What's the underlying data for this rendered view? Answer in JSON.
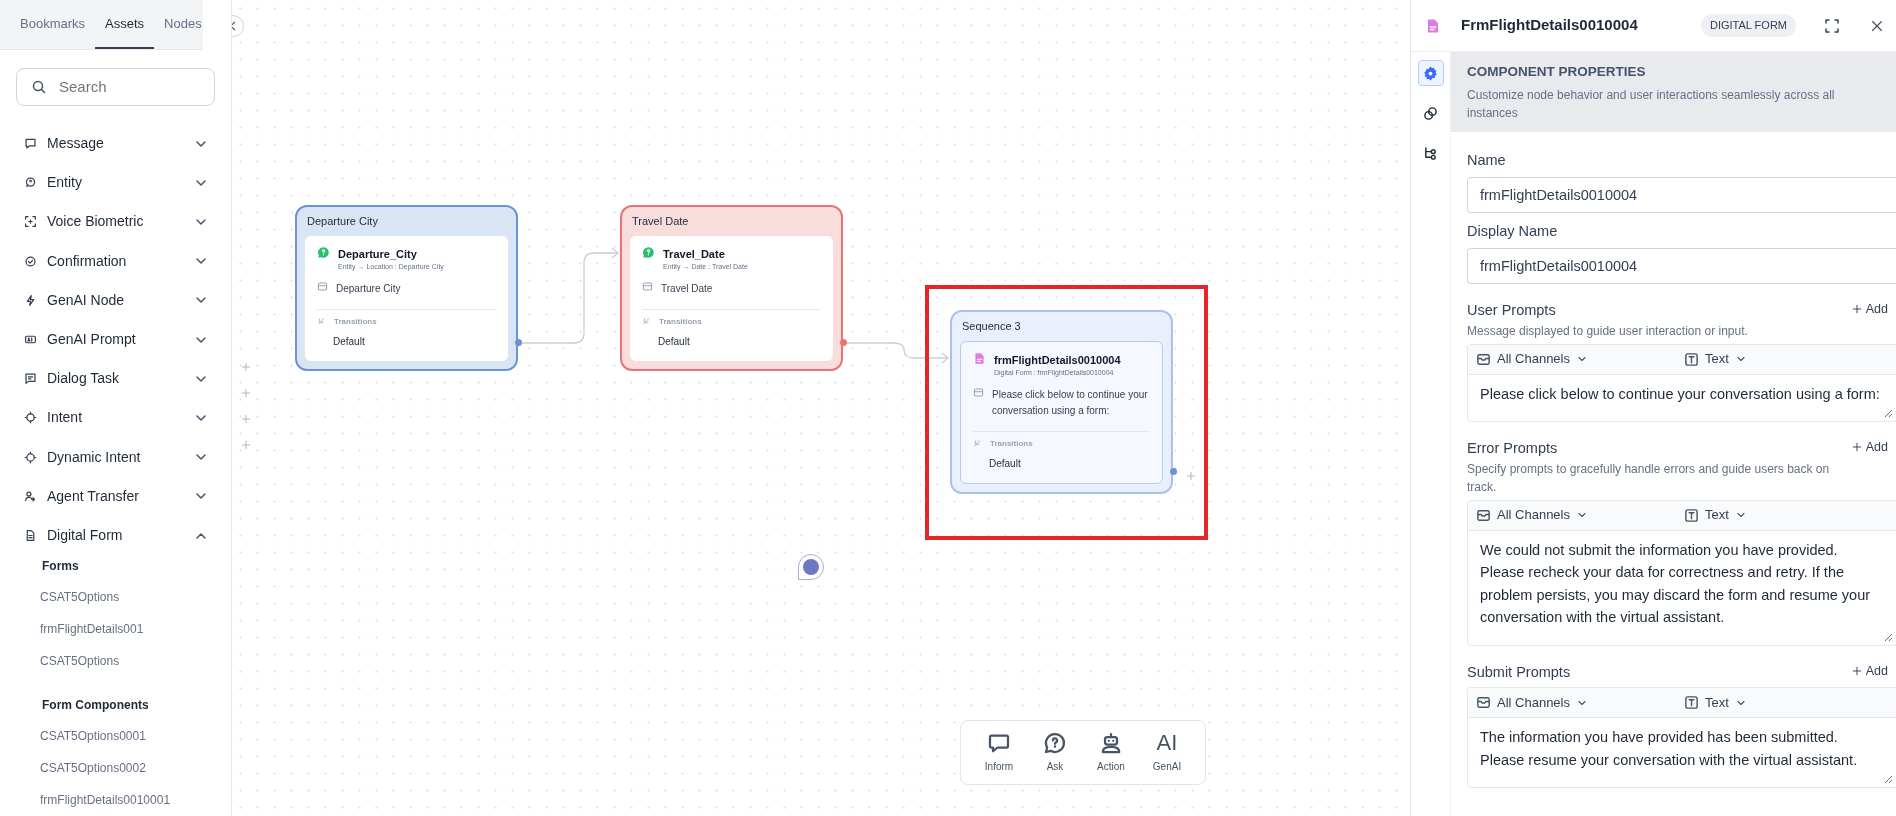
{
  "sidebar": {
    "tabs": [
      {
        "label": "Bookmarks",
        "selected": false
      },
      {
        "label": "Assets",
        "selected": true
      },
      {
        "label": "Nodes",
        "selected": false
      }
    ],
    "search": {
      "placeholder": "Search"
    },
    "items": [
      {
        "label": "Message",
        "expanded": false
      },
      {
        "label": "Entity",
        "expanded": false
      },
      {
        "label": "Voice Biometric",
        "expanded": false
      },
      {
        "label": "Confirmation",
        "expanded": false
      },
      {
        "label": "GenAI Node",
        "expanded": false
      },
      {
        "label": "GenAI Prompt",
        "expanded": false
      },
      {
        "label": "Dialog Task",
        "expanded": false
      },
      {
        "label": "Intent",
        "expanded": false
      },
      {
        "label": "Dynamic Intent",
        "expanded": false
      },
      {
        "label": "Agent Transfer",
        "expanded": false
      },
      {
        "label": "Digital Form",
        "expanded": true,
        "groups": [
          {
            "heading": "Forms",
            "items": [
              "CSAT5Options",
              "frmFlightDetails001",
              "CSAT5Options"
            ]
          },
          {
            "heading": "Form Components",
            "items": [
              "CSAT5Options0001",
              "CSAT5Options0002",
              "frmFlightDetails0010001"
            ]
          }
        ]
      }
    ]
  },
  "canvas": {
    "nodes": [
      {
        "title": "Departure City",
        "color": "#6a95d4",
        "kind": "entity",
        "name": "Departure_City",
        "path": "Entity → Location : Departure City",
        "prompt": "Departure City",
        "transitions_label": "Transitions",
        "transition": "Default",
        "highlighted": false
      },
      {
        "title": "Travel Date",
        "color": "#e87575",
        "kind": "entity",
        "name": "Travel_Date",
        "path": "Entity → Date : Travel Date",
        "prompt": "Travel Date",
        "transitions_label": "Transitions",
        "transition": "Default",
        "highlighted": false
      },
      {
        "title": "Sequence 3",
        "color": "#a9c1ef",
        "kind": "form",
        "name": "frmFlightDetails0010004",
        "path": "Digital Form : frmFlightDetails0010004",
        "prompt": "Please click below to continue your conversation using a form:",
        "transitions_label": "Transitions",
        "transition": "Default",
        "highlighted": true
      }
    ],
    "toolbar": [
      {
        "kind": "inform",
        "label": "Inform"
      },
      {
        "kind": "ask",
        "label": "Ask"
      },
      {
        "kind": "action",
        "label": "Action"
      },
      {
        "kind": "genai",
        "label": "GenAI",
        "icon_text": "AI"
      }
    ]
  },
  "panel": {
    "title": "FrmFlightDetails0010004",
    "badge": "DIGITAL FORM",
    "rail": [
      {
        "kind": "settings",
        "selected": true
      },
      {
        "kind": "links",
        "selected": false
      },
      {
        "kind": "flow",
        "selected": false
      }
    ],
    "section": {
      "title": "COMPONENT PROPERTIES",
      "description": "Customize node behavior and user interactions seamlessly across all instances"
    },
    "fields": [
      {
        "label": "Name",
        "value": "frmFlightDetails0010004"
      },
      {
        "label": "Display Name",
        "value": "frmFlightDetails0010004"
      }
    ],
    "prompts": [
      {
        "title": "User Prompts",
        "description": "Message displayed to guide user interaction or input.",
        "add": "Add",
        "channel": "All Channels",
        "format": "Text",
        "text": "Please click below to continue your conversation using a form:"
      },
      {
        "title": "Error Prompts",
        "description": "Specify prompts to gracefully handle errors and guide users back on track.",
        "add": "Add",
        "channel": "All Channels",
        "format": "Text",
        "text": "We could not submit the information you have provided. Please recheck your data for correctness and retry. If the problem persists, you may discard the form and resume your conversation with the virtual assistant."
      },
      {
        "title": "Submit Prompts",
        "add": "Add",
        "channel": "All Channels",
        "format": "Text",
        "text": "The information you have provided has been submitted. Please resume your conversation with the virtual assistant."
      }
    ]
  }
}
